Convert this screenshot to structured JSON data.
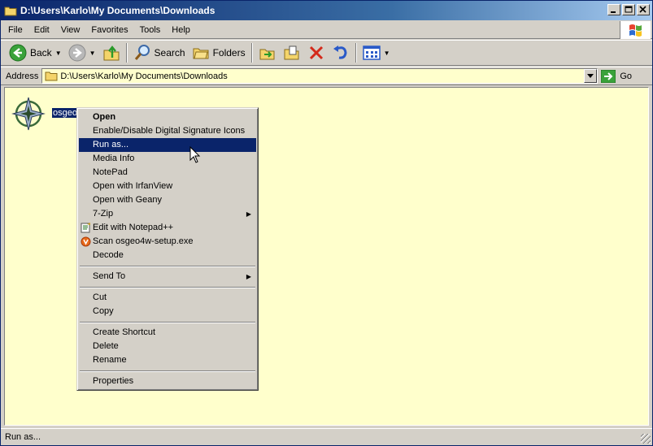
{
  "window": {
    "title": "D:\\Users\\Karlo\\My Documents\\Downloads",
    "minimize": "0",
    "maximize": "1",
    "close": "r"
  },
  "menubar": {
    "items": [
      "File",
      "Edit",
      "View",
      "Favorites",
      "Tools",
      "Help"
    ]
  },
  "toolbar": {
    "back_label": "Back",
    "search_label": "Search",
    "folders_label": "Folders"
  },
  "address": {
    "label": "Address",
    "path": "D:\\Users\\Karlo\\My Documents\\Downloads",
    "go_label": "Go"
  },
  "file": {
    "name": "osgeo4w-setup.exe",
    "visible_name": "osgeo4"
  },
  "context_menu": {
    "open": "Open",
    "digital_signature": "Enable/Disable Digital Signature Icons",
    "run_as": "Run as...",
    "media_info": "Media Info",
    "notepad": "NotePad",
    "open_irfanview": "Open with IrfanView",
    "open_geany": "Open with Geany",
    "seven_zip": "7-Zip",
    "edit_notepadpp": "Edit with Notepad++",
    "scan": "Scan osgeo4w-setup.exe",
    "decode": "Decode",
    "send_to": "Send To",
    "cut": "Cut",
    "copy": "Copy",
    "create_shortcut": "Create Shortcut",
    "delete": "Delete",
    "rename": "Rename",
    "properties": "Properties"
  },
  "status": {
    "text": "Run as..."
  },
  "colors": {
    "highlight": "#0a246a",
    "content_bg": "#ffffcc",
    "chrome": "#d4d0c8"
  }
}
